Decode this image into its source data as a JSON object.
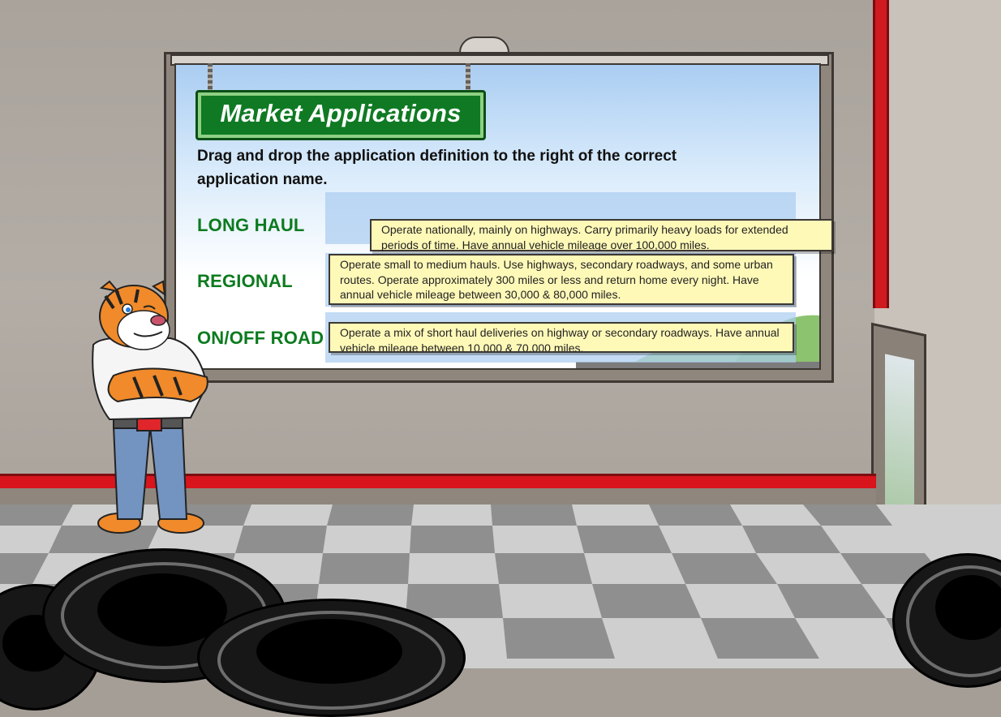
{
  "title": "Market Applications",
  "instructions": "Drag and drop the application definition to the right of the correct application name.",
  "categories": [
    {
      "name": "LONG HAUL"
    },
    {
      "name": "REGIONAL"
    },
    {
      "name": "ON/OFF ROAD"
    }
  ],
  "cards": [
    {
      "text": "Operate nationally, mainly on highways. Carry primarily heavy loads for extended periods of time. Have annual vehicle mileage over 100,000 miles."
    },
    {
      "text": "Operate small to medium hauls. Use highways, secondary roadways, and some urban routes. Operate approximately 300 miles or less and return home every night. Have annual vehicle mileage between 30,000 & 80,000 miles."
    },
    {
      "text": "Operate a mix of short haul deliveries on highway or secondary roadways. Have annual vehicle mileage between 10,000 & 70,000 miles."
    }
  ],
  "colors": {
    "title_green": "#0f7a23",
    "label_green": "#0c7b1f",
    "card_yellow": "#fff9b8",
    "accent_red": "#d8141c"
  }
}
